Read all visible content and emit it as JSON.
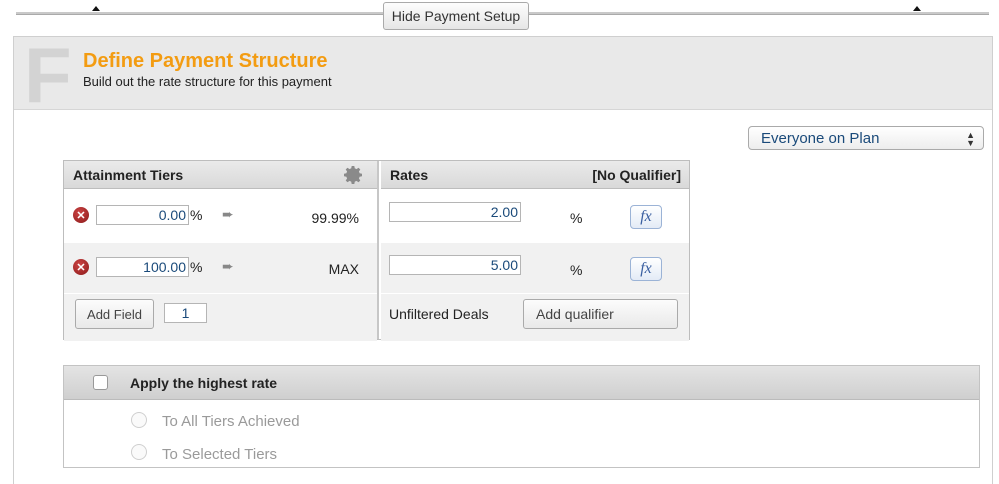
{
  "topbar": {
    "hide_label": "Hide Payment Setup"
  },
  "header": {
    "badge_letter": "F",
    "title": "Define Payment Structure",
    "subtitle": "Build out the rate structure for this payment"
  },
  "filter": {
    "selected": "Everyone on Plan",
    "arrows": "▲▼"
  },
  "tiers": {
    "header": "Attainment Tiers",
    "rows": [
      {
        "lower": "0.00",
        "unit": "%",
        "arrow": "➨",
        "upper": "99.99%"
      },
      {
        "lower": "100.00",
        "unit": "%",
        "arrow": "➨",
        "upper": "MAX"
      }
    ],
    "add_field_label": "Add Field",
    "add_count": "1",
    "delete_glyph": "✕"
  },
  "rates": {
    "header": "Rates",
    "qualifier_label": "[No Qualifier]",
    "rows": [
      {
        "rate": "2.00",
        "unit": "%",
        "fx": "fx"
      },
      {
        "rate": "5.00",
        "unit": "%",
        "fx": "fx"
      }
    ],
    "unfiltered_label": "Unfiltered Deals",
    "add_qualifier_label": "Add qualifier"
  },
  "highest_rate": {
    "title": "Apply the highest rate",
    "checked": false,
    "options": [
      "To All Tiers Achieved",
      "To Selected Tiers"
    ]
  },
  "colors": {
    "accent": "#f39c12",
    "link": "#1a4a7a",
    "delete": "#8b1a1a"
  }
}
